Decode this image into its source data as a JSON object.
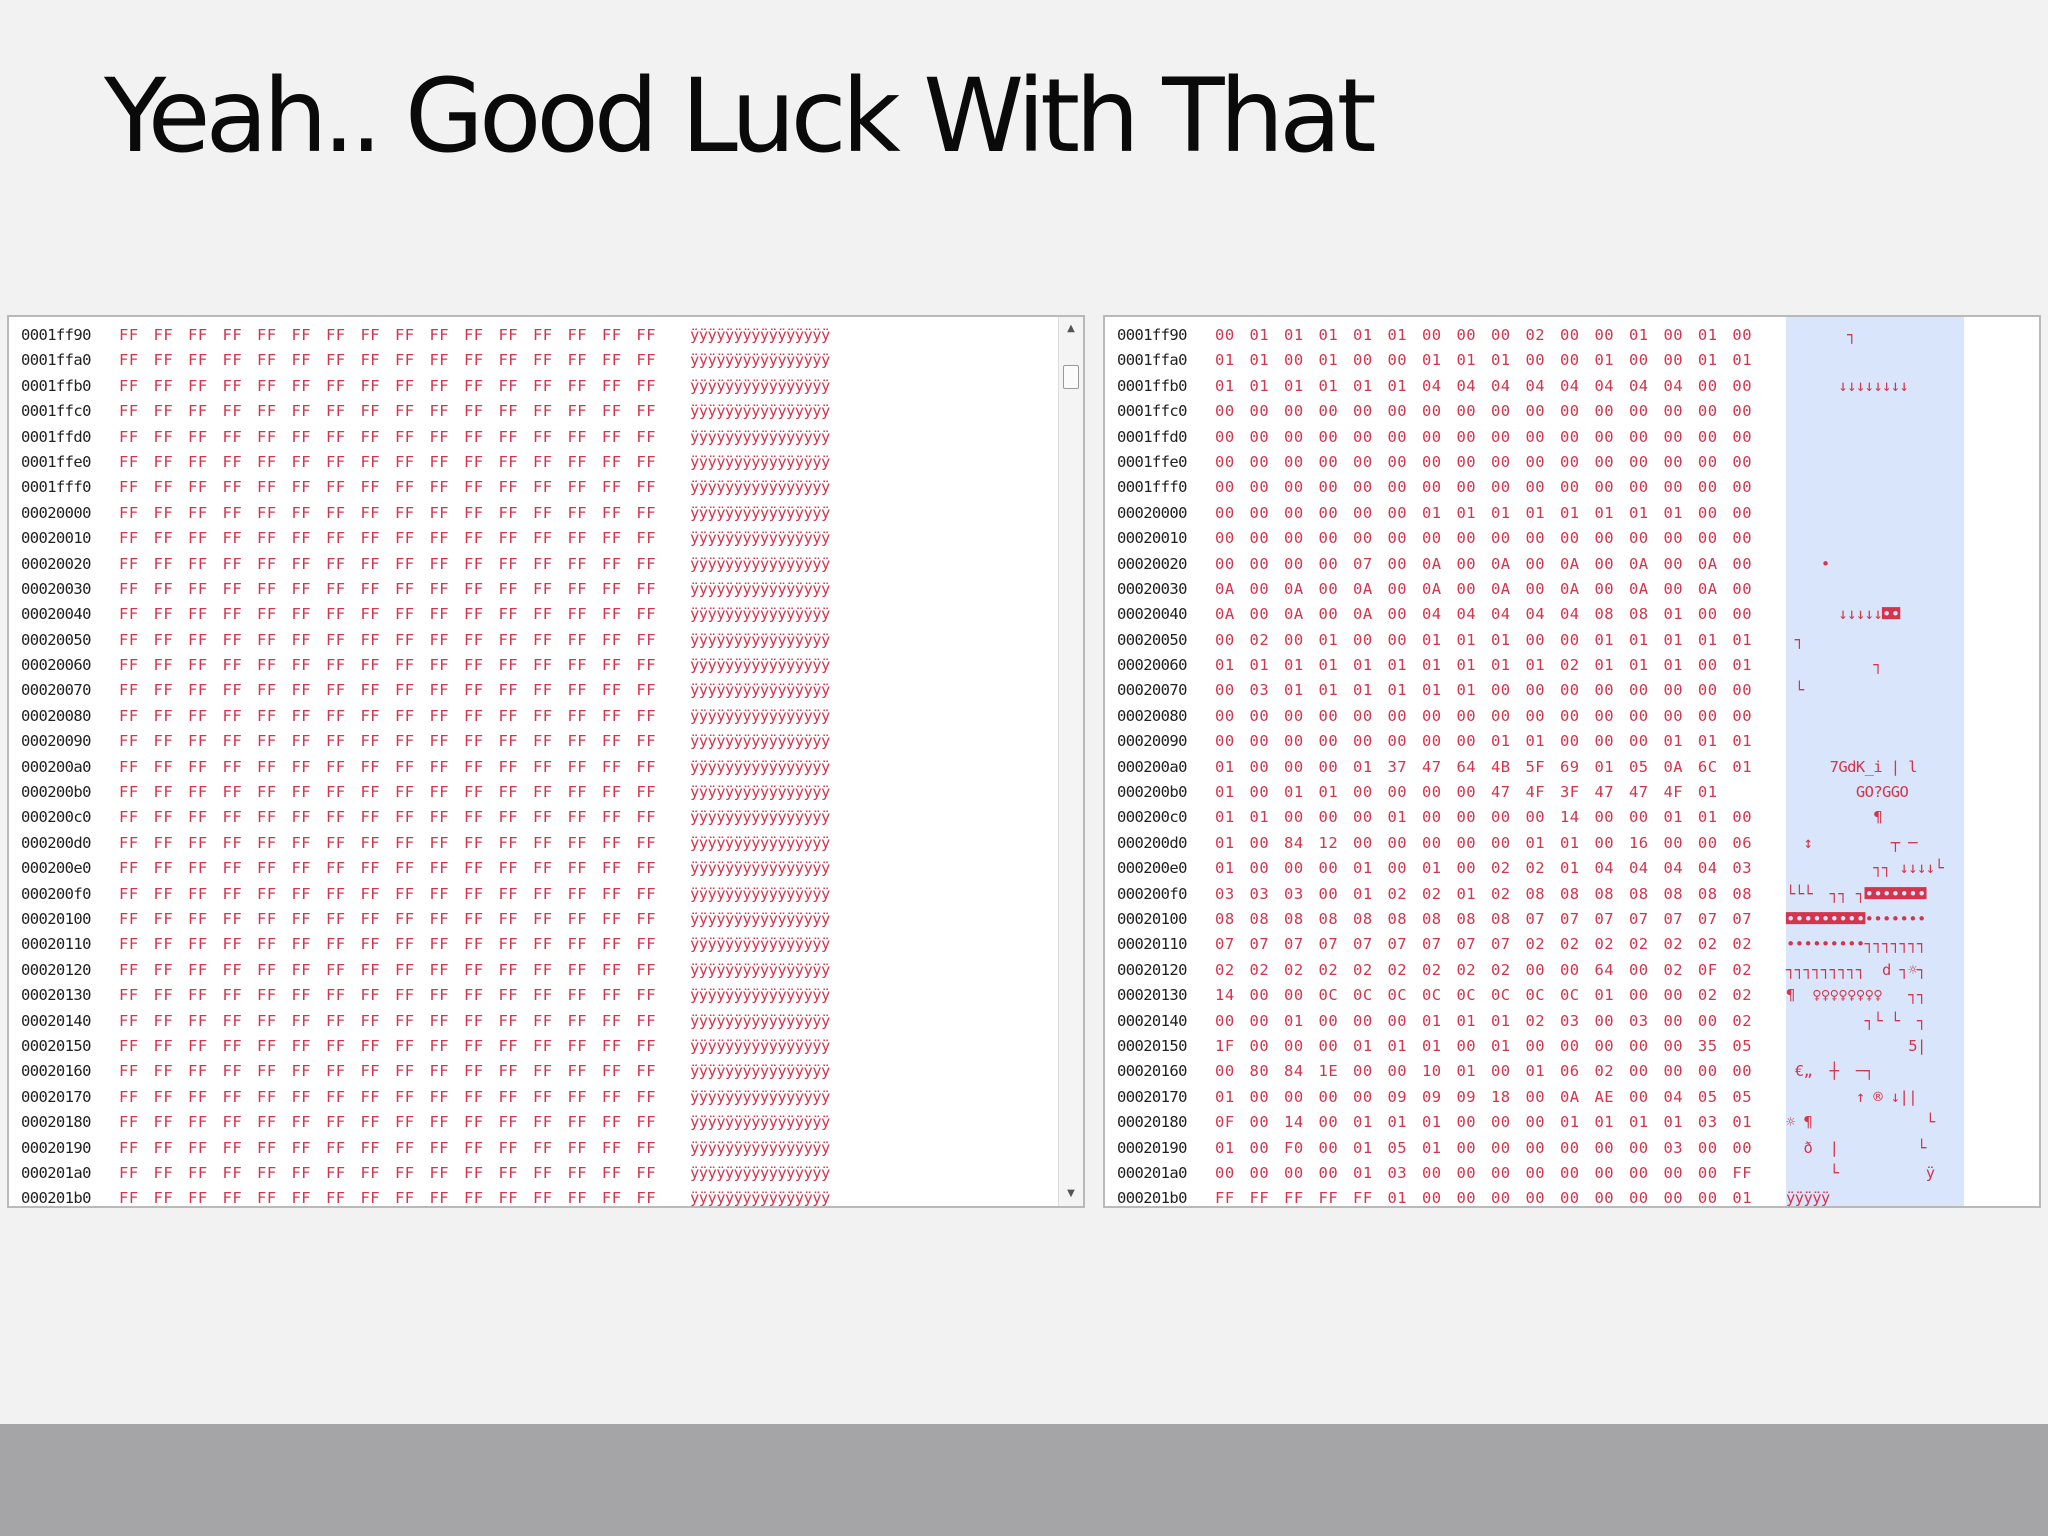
{
  "slide": {
    "title": "Yeah.. Good Luck With That"
  },
  "left_panel": {
    "rows": [
      {
        "addr": "0001ff90",
        "bytes": "FF FF FF FF FF FF FF FF FF FF FF FF FF FF FF FF",
        "ascii": "ÿÿÿÿÿÿÿÿÿÿÿÿÿÿÿÿ"
      },
      {
        "addr": "0001ffa0",
        "bytes": "FF FF FF FF FF FF FF FF FF FF FF FF FF FF FF FF",
        "ascii": "ÿÿÿÿÿÿÿÿÿÿÿÿÿÿÿÿ"
      },
      {
        "addr": "0001ffb0",
        "bytes": "FF FF FF FF FF FF FF FF FF FF FF FF FF FF FF FF",
        "ascii": "ÿÿÿÿÿÿÿÿÿÿÿÿÿÿÿÿ"
      },
      {
        "addr": "0001ffc0",
        "bytes": "FF FF FF FF FF FF FF FF FF FF FF FF FF FF FF FF",
        "ascii": "ÿÿÿÿÿÿÿÿÿÿÿÿÿÿÿÿ"
      },
      {
        "addr": "0001ffd0",
        "bytes": "FF FF FF FF FF FF FF FF FF FF FF FF FF FF FF FF",
        "ascii": "ÿÿÿÿÿÿÿÿÿÿÿÿÿÿÿÿ"
      },
      {
        "addr": "0001ffe0",
        "bytes": "FF FF FF FF FF FF FF FF FF FF FF FF FF FF FF FF",
        "ascii": "ÿÿÿÿÿÿÿÿÿÿÿÿÿÿÿÿ"
      },
      {
        "addr": "0001fff0",
        "bytes": "FF FF FF FF FF FF FF FF FF FF FF FF FF FF FF FF",
        "ascii": "ÿÿÿÿÿÿÿÿÿÿÿÿÿÿÿÿ"
      },
      {
        "addr": "00020000",
        "bytes": "FF FF FF FF FF FF FF FF FF FF FF FF FF FF FF FF",
        "ascii": "ÿÿÿÿÿÿÿÿÿÿÿÿÿÿÿÿ"
      },
      {
        "addr": "00020010",
        "bytes": "FF FF FF FF FF FF FF FF FF FF FF FF FF FF FF FF",
        "ascii": "ÿÿÿÿÿÿÿÿÿÿÿÿÿÿÿÿ"
      },
      {
        "addr": "00020020",
        "bytes": "FF FF FF FF FF FF FF FF FF FF FF FF FF FF FF FF",
        "ascii": "ÿÿÿÿÿÿÿÿÿÿÿÿÿÿÿÿ"
      },
      {
        "addr": "00020030",
        "bytes": "FF FF FF FF FF FF FF FF FF FF FF FF FF FF FF FF",
        "ascii": "ÿÿÿÿÿÿÿÿÿÿÿÿÿÿÿÿ"
      },
      {
        "addr": "00020040",
        "bytes": "FF FF FF FF FF FF FF FF FF FF FF FF FF FF FF FF",
        "ascii": "ÿÿÿÿÿÿÿÿÿÿÿÿÿÿÿÿ"
      },
      {
        "addr": "00020050",
        "bytes": "FF FF FF FF FF FF FF FF FF FF FF FF FF FF FF FF",
        "ascii": "ÿÿÿÿÿÿÿÿÿÿÿÿÿÿÿÿ"
      },
      {
        "addr": "00020060",
        "bytes": "FF FF FF FF FF FF FF FF FF FF FF FF FF FF FF FF",
        "ascii": "ÿÿÿÿÿÿÿÿÿÿÿÿÿÿÿÿ"
      },
      {
        "addr": "00020070",
        "bytes": "FF FF FF FF FF FF FF FF FF FF FF FF FF FF FF FF",
        "ascii": "ÿÿÿÿÿÿÿÿÿÿÿÿÿÿÿÿ"
      },
      {
        "addr": "00020080",
        "bytes": "FF FF FF FF FF FF FF FF FF FF FF FF FF FF FF FF",
        "ascii": "ÿÿÿÿÿÿÿÿÿÿÿÿÿÿÿÿ"
      },
      {
        "addr": "00020090",
        "bytes": "FF FF FF FF FF FF FF FF FF FF FF FF FF FF FF FF",
        "ascii": "ÿÿÿÿÿÿÿÿÿÿÿÿÿÿÿÿ"
      },
      {
        "addr": "000200a0",
        "bytes": "FF FF FF FF FF FF FF FF FF FF FF FF FF FF FF FF",
        "ascii": "ÿÿÿÿÿÿÿÿÿÿÿÿÿÿÿÿ"
      },
      {
        "addr": "000200b0",
        "bytes": "FF FF FF FF FF FF FF FF FF FF FF FF FF FF FF FF",
        "ascii": "ÿÿÿÿÿÿÿÿÿÿÿÿÿÿÿÿ"
      },
      {
        "addr": "000200c0",
        "bytes": "FF FF FF FF FF FF FF FF FF FF FF FF FF FF FF FF",
        "ascii": "ÿÿÿÿÿÿÿÿÿÿÿÿÿÿÿÿ"
      },
      {
        "addr": "000200d0",
        "bytes": "FF FF FF FF FF FF FF FF FF FF FF FF FF FF FF FF",
        "ascii": "ÿÿÿÿÿÿÿÿÿÿÿÿÿÿÿÿ"
      },
      {
        "addr": "000200e0",
        "bytes": "FF FF FF FF FF FF FF FF FF FF FF FF FF FF FF FF",
        "ascii": "ÿÿÿÿÿÿÿÿÿÿÿÿÿÿÿÿ"
      },
      {
        "addr": "000200f0",
        "bytes": "FF FF FF FF FF FF FF FF FF FF FF FF FF FF FF FF",
        "ascii": "ÿÿÿÿÿÿÿÿÿÿÿÿÿÿÿÿ"
      },
      {
        "addr": "00020100",
        "bytes": "FF FF FF FF FF FF FF FF FF FF FF FF FF FF FF FF",
        "ascii": "ÿÿÿÿÿÿÿÿÿÿÿÿÿÿÿÿ"
      },
      {
        "addr": "00020110",
        "bytes": "FF FF FF FF FF FF FF FF FF FF FF FF FF FF FF FF",
        "ascii": "ÿÿÿÿÿÿÿÿÿÿÿÿÿÿÿÿ"
      },
      {
        "addr": "00020120",
        "bytes": "FF FF FF FF FF FF FF FF FF FF FF FF FF FF FF FF",
        "ascii": "ÿÿÿÿÿÿÿÿÿÿÿÿÿÿÿÿ"
      },
      {
        "addr": "00020130",
        "bytes": "FF FF FF FF FF FF FF FF FF FF FF FF FF FF FF FF",
        "ascii": "ÿÿÿÿÿÿÿÿÿÿÿÿÿÿÿÿ"
      },
      {
        "addr": "00020140",
        "bytes": "FF FF FF FF FF FF FF FF FF FF FF FF FF FF FF FF",
        "ascii": "ÿÿÿÿÿÿÿÿÿÿÿÿÿÿÿÿ"
      },
      {
        "addr": "00020150",
        "bytes": "FF FF FF FF FF FF FF FF FF FF FF FF FF FF FF FF",
        "ascii": "ÿÿÿÿÿÿÿÿÿÿÿÿÿÿÿÿ"
      },
      {
        "addr": "00020160",
        "bytes": "FF FF FF FF FF FF FF FF FF FF FF FF FF FF FF FF",
        "ascii": "ÿÿÿÿÿÿÿÿÿÿÿÿÿÿÿÿ"
      },
      {
        "addr": "00020170",
        "bytes": "FF FF FF FF FF FF FF FF FF FF FF FF FF FF FF FF",
        "ascii": "ÿÿÿÿÿÿÿÿÿÿÿÿÿÿÿÿ"
      },
      {
        "addr": "00020180",
        "bytes": "FF FF FF FF FF FF FF FF FF FF FF FF FF FF FF FF",
        "ascii": "ÿÿÿÿÿÿÿÿÿÿÿÿÿÿÿÿ"
      },
      {
        "addr": "00020190",
        "bytes": "FF FF FF FF FF FF FF FF FF FF FF FF FF FF FF FF",
        "ascii": "ÿÿÿÿÿÿÿÿÿÿÿÿÿÿÿÿ"
      },
      {
        "addr": "000201a0",
        "bytes": "FF FF FF FF FF FF FF FF FF FF FF FF FF FF FF FF",
        "ascii": "ÿÿÿÿÿÿÿÿÿÿÿÿÿÿÿÿ"
      },
      {
        "addr": "000201b0",
        "bytes": "FF FF FF FF FF FF FF FF FF FF FF FF FF FF FF FF",
        "ascii": "ÿÿÿÿÿÿÿÿÿÿÿÿÿÿÿÿ"
      }
    ],
    "scrollbar": {
      "up_icon": "▲",
      "down_icon": "▼"
    }
  },
  "right_panel": {
    "rows": [
      {
        "addr": "0001ff90",
        "bytes": "00 01 01 01 01 01 00 00 00 02 00 00 01 00 01 00",
        "ascii": "       ┐"
      },
      {
        "addr": "0001ffa0",
        "bytes": "01 01 00 01 00 00 01 01 01 00 00 01 00 00 01 01",
        "ascii": ""
      },
      {
        "addr": "0001ffb0",
        "bytes": "01 01 01 01 01 01 04 04 04 04 04 04 04 04 00 00",
        "ascii": "      ↓↓↓↓↓↓↓↓"
      },
      {
        "addr": "0001ffc0",
        "bytes": "00 00 00 00 00 00 00 00 00 00 00 00 00 00 00 00",
        "ascii": ""
      },
      {
        "addr": "0001ffd0",
        "bytes": "00 00 00 00 00 00 00 00 00 00 00 00 00 00 00 00",
        "ascii": ""
      },
      {
        "addr": "0001ffe0",
        "bytes": "00 00 00 00 00 00 00 00 00 00 00 00 00 00 00 00",
        "ascii": ""
      },
      {
        "addr": "0001fff0",
        "bytes": "00 00 00 00 00 00 00 00 00 00 00 00 00 00 00 00",
        "ascii": ""
      },
      {
        "addr": "00020000",
        "bytes": "00 00 00 00 00 00 01 01 01 01 01 01 01 01 00 00",
        "ascii": ""
      },
      {
        "addr": "00020010",
        "bytes": "00 00 00 00 00 00 00 00 00 00 00 00 00 00 00 00",
        "ascii": ""
      },
      {
        "addr": "00020020",
        "bytes": "00 00 00 00 07 00 0A 00 0A 00 0A 00 0A 00 0A 00",
        "ascii": "    •"
      },
      {
        "addr": "00020030",
        "bytes": "0A 00 0A 00 0A 00 0A 00 0A 00 0A 00 0A 00 0A 00",
        "ascii": ""
      },
      {
        "addr": "00020040",
        "bytes": "0A 00 0A 00 0A 00 04 04 04 04 04 08 08 01 00 00",
        "ascii": "      ↓↓↓↓↓◘◘"
      },
      {
        "addr": "00020050",
        "bytes": "00 02 00 01 00 00 01 01 01 00 00 01 01 01 01 01",
        "ascii": " ┐"
      },
      {
        "addr": "00020060",
        "bytes": "01 01 01 01 01 01 01 01 01 01 02 01 01 01 00 01",
        "ascii": "          ┐"
      },
      {
        "addr": "00020070",
        "bytes": "00 03 01 01 01 01 01 01 00 00 00 00 00 00 00 00",
        "ascii": " └"
      },
      {
        "addr": "00020080",
        "bytes": "00 00 00 00 00 00 00 00 00 00 00 00 00 00 00 00",
        "ascii": ""
      },
      {
        "addr": "00020090",
        "bytes": "00 00 00 00 00 00 00 00 01 01 00 00 00 01 01 01",
        "ascii": ""
      },
      {
        "addr": "000200a0",
        "bytes": "01 00 00 00 01 37 47 64 4B 5F 69 01 05 0A 6C 01",
        "ascii": "     7GdK_i | l"
      },
      {
        "addr": "000200b0",
        "bytes": "01 00 01 01 00 00 00 00 47 4F 3F 47 47 4F 01",
        "ascii": "        GO?GGO"
      },
      {
        "addr": "000200c0",
        "bytes": "01 01 00 00 00 01 00 00 00 00 14 00 00 01 01 00",
        "ascii": "          ¶"
      },
      {
        "addr": "000200d0",
        "bytes": "01 00 84 12 00 00 00 00 00 01 01 00 16 00 00 06",
        "ascii": "  ↕         ┬ ─"
      },
      {
        "addr": "000200e0",
        "bytes": "01 00 00 00 01 00 01 00 02 02 01 04 04 04 04 03",
        "ascii": "          ┐┐ ↓↓↓↓└"
      },
      {
        "addr": "000200f0",
        "bytes": "03 03 03 00 01 02 02 01 02 08 08 08 08 08 08 08",
        "ascii": "└└└  ┐┐ ┐◘◘◘◘◘◘◘"
      },
      {
        "addr": "00020100",
        "bytes": "08 08 08 08 08 08 08 08 08 07 07 07 07 07 07 07",
        "ascii": "◘◘◘◘◘◘◘◘◘•••••••"
      },
      {
        "addr": "00020110",
        "bytes": "07 07 07 07 07 07 07 07 07 02 02 02 02 02 02 02",
        "ascii": "•••••••••┐┐┐┐┐┐┐"
      },
      {
        "addr": "00020120",
        "bytes": "02 02 02 02 02 02 02 02 02 00 00 64 00 02 0F 02",
        "ascii": "┐┐┐┐┐┐┐┐┐  d ┐☼┐"
      },
      {
        "addr": "00020130",
        "bytes": "14 00 00 0C 0C 0C 0C 0C 0C 0C 0C 01 00 00 02 02",
        "ascii": "¶  ♀♀♀♀♀♀♀♀   ┐┐"
      },
      {
        "addr": "00020140",
        "bytes": "00 00 01 00 00 00 01 01 01 02 03 00 03 00 00 02",
        "ascii": "         ┐└ └  ┐"
      },
      {
        "addr": "00020150",
        "bytes": "1F 00 00 00 01 01 01 00 01 00 00 00 00 00 35 05",
        "ascii": "              5|"
      },
      {
        "addr": "00020160",
        "bytes": "00 80 84 1E 00 00 10 01 00 01 06 02 00 00 00 00",
        "ascii": " €„  ┼  ─┐"
      },
      {
        "addr": "00020170",
        "bytes": "01 00 00 00 00 09 09 09 18 00 0A AE 00 04 05 05",
        "ascii": "        ↑ ® ↓||"
      },
      {
        "addr": "00020180",
        "bytes": "0F 00 14 00 01 01 01 00 00 00 01 01 01 01 03 01",
        "ascii": "☼ ¶             └"
      },
      {
        "addr": "00020190",
        "bytes": "01 00 F0 00 01 05 01 00 00 00 00 00 00 03 00 00",
        "ascii": "  ð  |         └"
      },
      {
        "addr": "000201a0",
        "bytes": "00 00 00 00 01 03 00 00 00 00 00 00 00 00 00 FF",
        "ascii": "     └          ÿ"
      },
      {
        "addr": "000201b0",
        "bytes": "FF FF FF FF FF 01 00 00 00 00 00 00 00 00 00 01",
        "ascii": "ÿÿÿÿÿ"
      }
    ]
  },
  "colors": {
    "background": "#f2f2f2",
    "footer": "#a5a5a7",
    "byte_text": "#d4344c",
    "address_text": "#202020",
    "ascii_highlight": "#d8e5fb"
  }
}
